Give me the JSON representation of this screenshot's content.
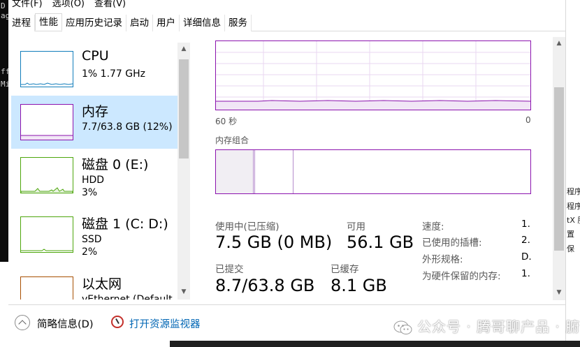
{
  "menu": [
    "文件(F)",
    "选项(O)",
    "查看(V)"
  ],
  "tabs": [
    {
      "label": "进程"
    },
    {
      "label": "性能",
      "active": true
    },
    {
      "label": "应用历史记录"
    },
    {
      "label": "启动"
    },
    {
      "label": "用户"
    },
    {
      "label": "详细信息"
    },
    {
      "label": "服务"
    }
  ],
  "sidebar": {
    "items": [
      {
        "title": "CPU",
        "sub": "1% 1.77 GHz",
        "sub2": "",
        "color": "#117dbb"
      },
      {
        "title": "内存",
        "sub": "7.7/63.8 GB (12%)",
        "sub2": "",
        "color": "#8b12ae"
      },
      {
        "title": "磁盘 0 (E:)",
        "sub": "HDD",
        "sub2": "3%",
        "color": "#4da60c"
      },
      {
        "title": "磁盘 1 (C: D:)",
        "sub": "SSD",
        "sub2": "2%",
        "color": "#4da60c"
      },
      {
        "title": "以太网",
        "sub": "vEthernet (Default",
        "sub2": "",
        "color": "#a74f01"
      }
    ]
  },
  "main": {
    "graph_left_label": "60 秒",
    "graph_right_label": "0",
    "composition_label": "内存组合",
    "stats": {
      "in_use_label": "使用中(已压缩)",
      "in_use_value": "7.5 GB (0 MB)",
      "available_label": "可用",
      "available_value": "56.1 GB",
      "committed_label": "已提交",
      "committed_value": "8.7/63.8 GB",
      "cached_label": "已缓存",
      "cached_value": "8.1 GB"
    },
    "details": [
      {
        "label": "速度:",
        "value": "1."
      },
      {
        "label": "已使用的插槽:",
        "value": "2."
      },
      {
        "label": "外形规格:",
        "value": "D."
      },
      {
        "label": "为硬件保留的内存:",
        "value": "1."
      }
    ]
  },
  "footer": {
    "fewer_details": "简略信息(D)",
    "open_monitor": "打开资源监视器"
  },
  "watermark": "公众号 · 腾哥聊产品 · 腑",
  "background": {
    "left_chars": [
      "D",
      "ag",
      "ff",
      "Mi"
    ],
    "right_chars": [
      "程序",
      "程序",
      "tX 服",
      "置",
      "保"
    ]
  },
  "colors": {
    "accent_memory": "#8b12ae",
    "selection": "#cce8ff",
    "link": "#0066b4"
  }
}
